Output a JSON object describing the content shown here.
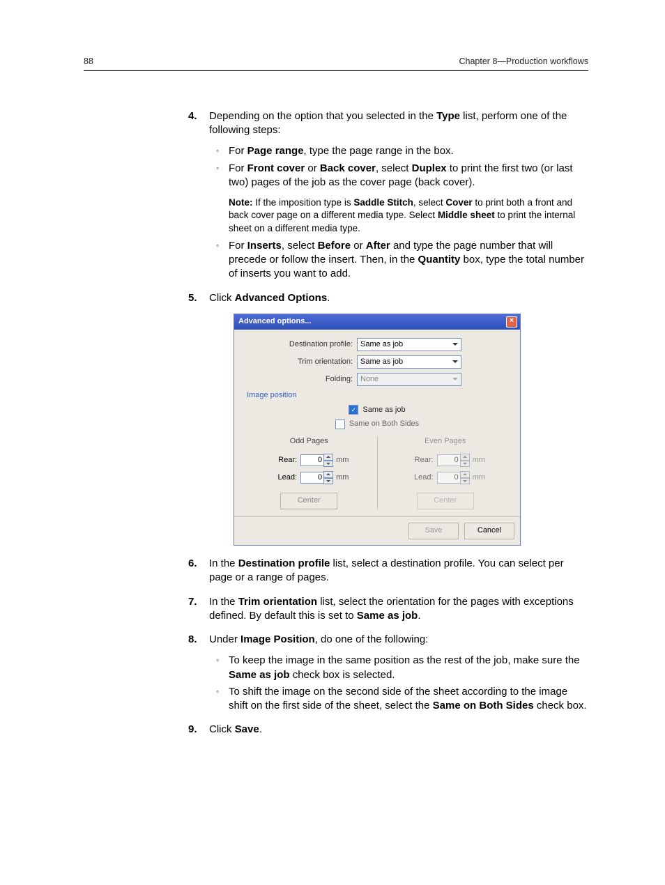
{
  "header": {
    "page_num": "88",
    "chapter": "Chapter 8—Production workflows"
  },
  "steps": {
    "s4": {
      "num": "4.",
      "text_a": "Depending on the option that you selected in the ",
      "type": "Type",
      "text_b": " list, perform one of the following steps:",
      "b1_a": "For ",
      "b1_pr": "Page range",
      "b1_b": ", type the page range in the box.",
      "b2_a": "For ",
      "b2_fc": "Front cover",
      "b2_or": " or ",
      "b2_bc": "Back cover",
      "b2_sel": ", select ",
      "b2_dx": "Duplex",
      "b2_b": " to print the first two (or last two) pages of the job as the cover page (back cover).",
      "note_lbl": "Note:",
      "note_a": " If the imposition type is ",
      "note_ss": "Saddle Stitch",
      "note_b": ", select ",
      "note_cv": "Cover",
      "note_c": " to print both a front and back cover page on a different media type. Select ",
      "note_ms": "Middle sheet",
      "note_d": " to print the internal sheet on a different media type.",
      "b3_a": "For ",
      "b3_ins": "Inserts",
      "b3_sel": ", select ",
      "b3_bf": "Before",
      "b3_or": " or ",
      "b3_af": "After",
      "b3_b": " and type the page number that will precede or follow the insert. Then, in the ",
      "b3_qty": "Quantity",
      "b3_c": " box, type the total number of inserts you want to add."
    },
    "s5": {
      "num": "5.",
      "a": "Click ",
      "ao": "Advanced Options",
      "b": "."
    },
    "s6": {
      "num": "6.",
      "a": "In the ",
      "dp": "Destination profile",
      "b": " list, select a destination profile. You can select per page or a range of pages."
    },
    "s7": {
      "num": "7.",
      "a": "In the ",
      "to": "Trim orientation",
      "b": " list, select the orientation for the pages with exceptions defined. By default this is set to ",
      "saj": "Same as job",
      "c": "."
    },
    "s8": {
      "num": "8.",
      "a": "Under ",
      "ip": "Image Position",
      "b": ", do one of the following:",
      "s8b1_a": "To keep the image in the same position as the rest of the job, make sure the ",
      "s8b1_s": "Same as job",
      "s8b1_b": " check box is selected.",
      "s8b2_a": "To shift the image on the second side of the sheet according to the image shift on the first side of the sheet, select the ",
      "s8b2_s": "Same on Both Sides",
      "s8b2_b": " check box."
    },
    "s9": {
      "num": "9.",
      "a": "Click ",
      "sv": "Save",
      "b": "."
    }
  },
  "dialog": {
    "title": "Advanced options...",
    "close": "×",
    "dest_lbl": "Destination profile:",
    "dest_val": "Same as job",
    "trim_lbl": "Trim orientation:",
    "trim_val": "Same as job",
    "fold_lbl": "Folding:",
    "fold_val": "None",
    "section": "Image position",
    "chk_same_job": "Same as job",
    "chk_both": "Same on Both Sides",
    "odd": "Odd Pages",
    "even": "Even Pages",
    "rear": "Rear:",
    "lead": "Lead:",
    "rear_val": "0",
    "lead_val": "0",
    "unit": "mm",
    "center": "Center",
    "save": "Save",
    "cancel": "Cancel"
  }
}
